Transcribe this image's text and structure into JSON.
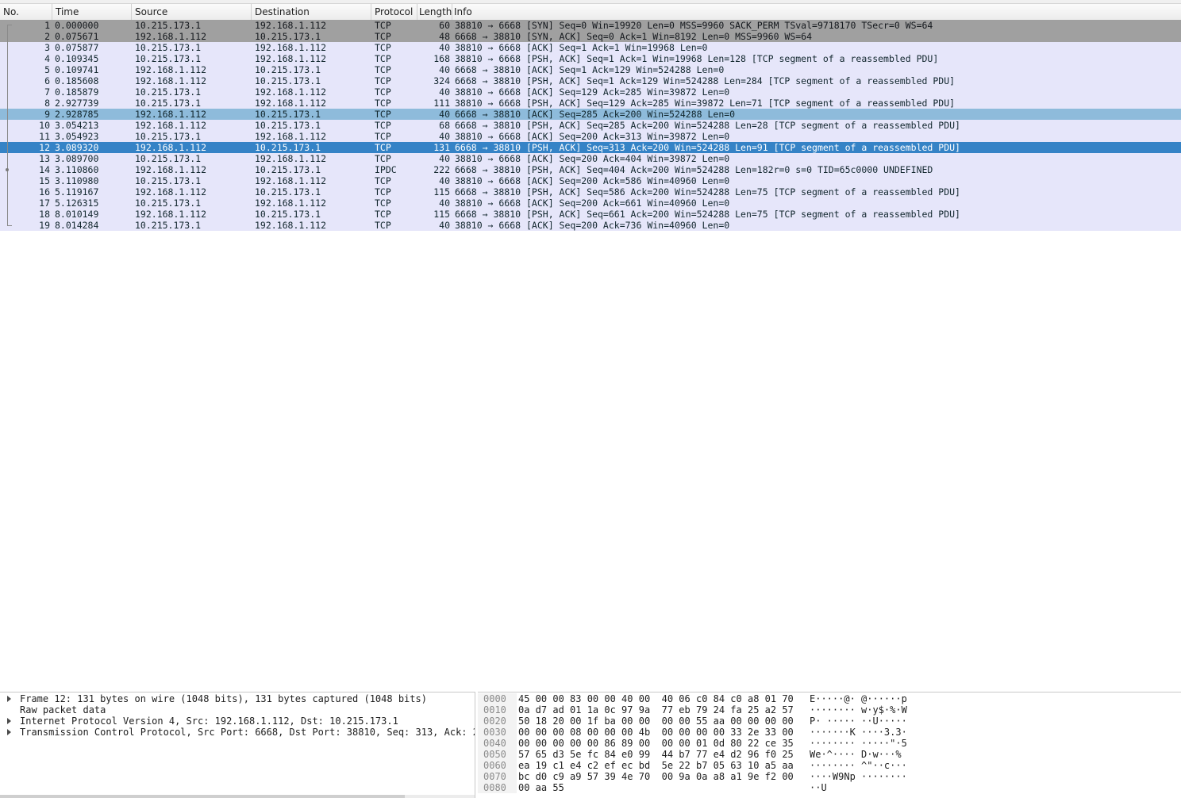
{
  "columns": {
    "no": "No.",
    "time": "Time",
    "source": "Source",
    "destination": "Destination",
    "protocol": "Protocol",
    "length": "Length",
    "info": "Info"
  },
  "packets": [
    {
      "no": "1",
      "time": "0.000000",
      "src": "10.215.173.1",
      "dst": "192.168.1.112",
      "proto": "TCP",
      "len": "60",
      "info": "38810 → 6668 [SYN] Seq=0 Win=19920 Len=0 MSS=9960 SACK_PERM TSval=9718170 TSecr=0 WS=64",
      "style": "gray"
    },
    {
      "no": "2",
      "time": "0.075671",
      "src": "192.168.1.112",
      "dst": "10.215.173.1",
      "proto": "TCP",
      "len": "48",
      "info": "6668 → 38810 [SYN, ACK] Seq=0 Ack=1 Win=8192 Len=0 MSS=9960 WS=64",
      "style": "gray"
    },
    {
      "no": "3",
      "time": "0.075877",
      "src": "10.215.173.1",
      "dst": "192.168.1.112",
      "proto": "TCP",
      "len": "40",
      "info": "38810 → 6668 [ACK] Seq=1 Ack=1 Win=19968 Len=0",
      "style": "lav"
    },
    {
      "no": "4",
      "time": "0.109345",
      "src": "10.215.173.1",
      "dst": "192.168.1.112",
      "proto": "TCP",
      "len": "168",
      "info": "38810 → 6668 [PSH, ACK] Seq=1 Ack=1 Win=19968 Len=128 [TCP segment of a reassembled PDU]",
      "style": "lav"
    },
    {
      "no": "5",
      "time": "0.109741",
      "src": "192.168.1.112",
      "dst": "10.215.173.1",
      "proto": "TCP",
      "len": "40",
      "info": "6668 → 38810 [ACK] Seq=1 Ack=129 Win=524288 Len=0",
      "style": "lav"
    },
    {
      "no": "6",
      "time": "0.185608",
      "src": "192.168.1.112",
      "dst": "10.215.173.1",
      "proto": "TCP",
      "len": "324",
      "info": "6668 → 38810 [PSH, ACK] Seq=1 Ack=129 Win=524288 Len=284 [TCP segment of a reassembled PDU]",
      "style": "lav"
    },
    {
      "no": "7",
      "time": "0.185879",
      "src": "10.215.173.1",
      "dst": "192.168.1.112",
      "proto": "TCP",
      "len": "40",
      "info": "38810 → 6668 [ACK] Seq=129 Ack=285 Win=39872 Len=0",
      "style": "lav"
    },
    {
      "no": "8",
      "time": "2.927739",
      "src": "10.215.173.1",
      "dst": "192.168.1.112",
      "proto": "TCP",
      "len": "111",
      "info": "38810 → 6668 [PSH, ACK] Seq=129 Ack=285 Win=39872 Len=71 [TCP segment of a reassembled PDU]",
      "style": "lav"
    },
    {
      "no": "9",
      "time": "2.928785",
      "src": "192.168.1.112",
      "dst": "10.215.173.1",
      "proto": "TCP",
      "len": "40",
      "info": "6668 → 38810 [ACK] Seq=285 Ack=200 Win=524288 Len=0",
      "style": "sel-light"
    },
    {
      "no": "10",
      "time": "3.054213",
      "src": "192.168.1.112",
      "dst": "10.215.173.1",
      "proto": "TCP",
      "len": "68",
      "info": "6668 → 38810 [PSH, ACK] Seq=285 Ack=200 Win=524288 Len=28 [TCP segment of a reassembled PDU]",
      "style": "lav"
    },
    {
      "no": "11",
      "time": "3.054923",
      "src": "10.215.173.1",
      "dst": "192.168.1.112",
      "proto": "TCP",
      "len": "40",
      "info": "38810 → 6668 [ACK] Seq=200 Ack=313 Win=39872 Len=0",
      "style": "lav"
    },
    {
      "no": "12",
      "time": "3.089320",
      "src": "192.168.1.112",
      "dst": "10.215.173.1",
      "proto": "TCP",
      "len": "131",
      "info": "6668 → 38810 [PSH, ACK] Seq=313 Ack=200 Win=524288 Len=91 [TCP segment of a reassembled PDU]",
      "style": "sel"
    },
    {
      "no": "13",
      "time": "3.089700",
      "src": "10.215.173.1",
      "dst": "192.168.1.112",
      "proto": "TCP",
      "len": "40",
      "info": "38810 → 6668 [ACK] Seq=200 Ack=404 Win=39872 Len=0",
      "style": "lav"
    },
    {
      "no": "14",
      "time": "3.110860",
      "src": "192.168.1.112",
      "dst": "10.215.173.1",
      "proto": "IPDC",
      "len": "222",
      "info": "6668 → 38810 [PSH, ACK] Seq=404 Ack=200 Win=524288 Len=182r=0 s=0 TID=65c0000 UNDEFINED",
      "style": "lav"
    },
    {
      "no": "15",
      "time": "3.110980",
      "src": "10.215.173.1",
      "dst": "192.168.1.112",
      "proto": "TCP",
      "len": "40",
      "info": "38810 → 6668 [ACK] Seq=200 Ack=586 Win=40960 Len=0",
      "style": "lav"
    },
    {
      "no": "16",
      "time": "5.119167",
      "src": "192.168.1.112",
      "dst": "10.215.173.1",
      "proto": "TCP",
      "len": "115",
      "info": "6668 → 38810 [PSH, ACK] Seq=586 Ack=200 Win=524288 Len=75 [TCP segment of a reassembled PDU]",
      "style": "lav"
    },
    {
      "no": "17",
      "time": "5.126315",
      "src": "10.215.173.1",
      "dst": "192.168.1.112",
      "proto": "TCP",
      "len": "40",
      "info": "38810 → 6668 [ACK] Seq=200 Ack=661 Win=40960 Len=0",
      "style": "lav"
    },
    {
      "no": "18",
      "time": "8.010149",
      "src": "192.168.1.112",
      "dst": "10.215.173.1",
      "proto": "TCP",
      "len": "115",
      "info": "6668 → 38810 [PSH, ACK] Seq=661 Ack=200 Win=524288 Len=75 [TCP segment of a reassembled PDU]",
      "style": "lav"
    },
    {
      "no": "19",
      "time": "8.014284",
      "src": "10.215.173.1",
      "dst": "192.168.1.112",
      "proto": "TCP",
      "len": "40",
      "info": "38810 → 6668 [ACK] Seq=200 Ack=736 Win=40960 Len=0",
      "style": "lav"
    }
  ],
  "details": [
    {
      "label": "Frame 12: 131 bytes on wire (1048 bits), 131 bytes captured (1048 bits)",
      "expandable": true
    },
    {
      "label": "Raw packet data",
      "expandable": false
    },
    {
      "label": "Internet Protocol Version 4, Src: 192.168.1.112, Dst: 10.215.173.1",
      "expandable": true
    },
    {
      "label": "Transmission Control Protocol, Src Port: 6668, Dst Port: 38810, Seq: 313, Ack: 2",
      "expandable": true
    }
  ],
  "bytes": [
    {
      "offset": "0000",
      "hex": "45 00 00 83 00 00 40 00  40 06 c0 84 c0 a8 01 70",
      "ascii": "E·····@· @······p"
    },
    {
      "offset": "0010",
      "hex": "0a d7 ad 01 1a 0c 97 9a  77 eb 79 24 fa 25 a2 57",
      "ascii": "········ w·y$·%·W"
    },
    {
      "offset": "0020",
      "hex": "50 18 20 00 1f ba 00 00  00 00 55 aa 00 00 00 00",
      "ascii": "P· ····· ··U·····"
    },
    {
      "offset": "0030",
      "hex": "00 00 00 08 00 00 00 4b  00 00 00 00 33 2e 33 00",
      "ascii": "·······K ····3.3·"
    },
    {
      "offset": "0040",
      "hex": "00 00 00 00 00 86 89 00  00 00 01 0d 80 22 ce 35",
      "ascii": "········ ·····\"·5"
    },
    {
      "offset": "0050",
      "hex": "57 65 d3 5e fc 84 e0 99  44 b7 77 e4 d2 96 f0 25",
      "ascii": "We·^···· D·w···%"
    },
    {
      "offset": "0060",
      "hex": "ea 19 c1 e4 c2 ef ec bd  5e 22 b7 05 63 10 a5 aa",
      "ascii": "········ ^\"··c···"
    },
    {
      "offset": "0070",
      "hex": "bc d0 c9 a9 57 39 4e 70  00 9a 0a a8 a1 9e f2 00",
      "ascii": "····W9Np ········"
    },
    {
      "offset": "0080",
      "hex": "00 aa 55",
      "ascii": "··U"
    }
  ]
}
